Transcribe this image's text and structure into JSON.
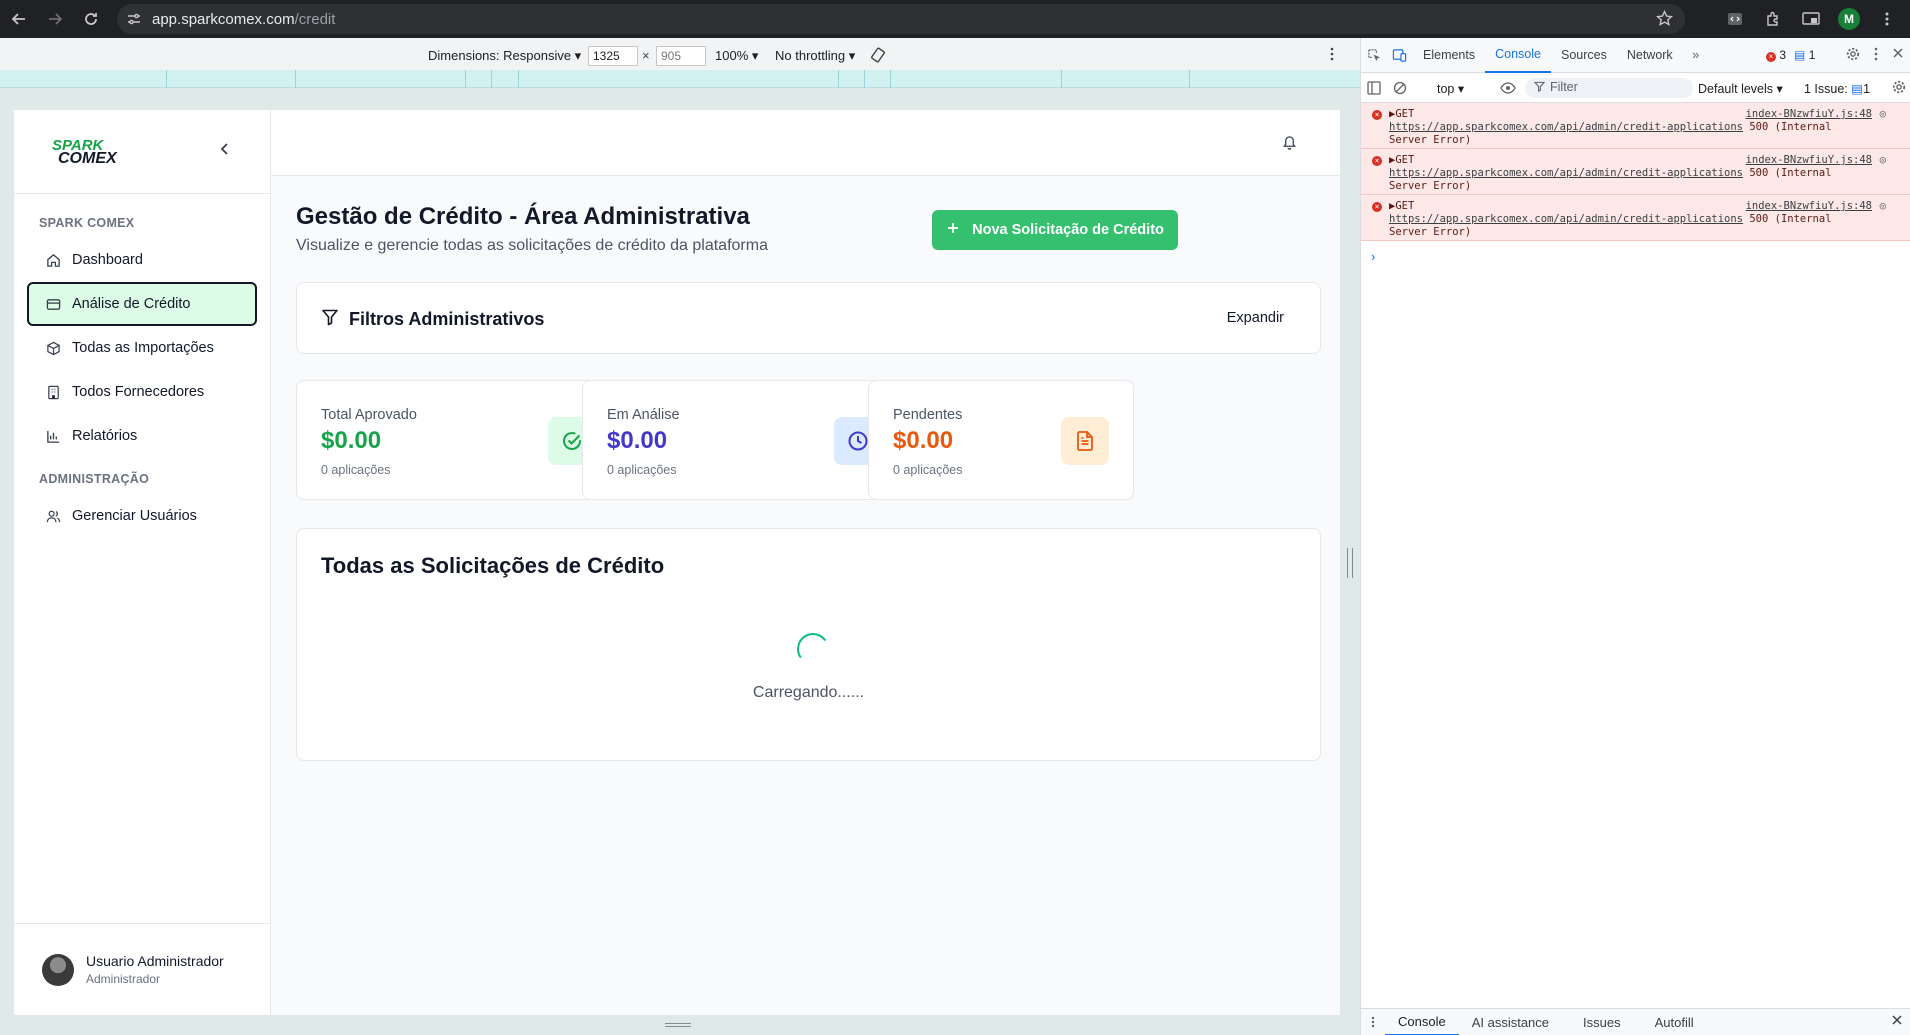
{
  "browser": {
    "url_host": "app.sparkcomex.com",
    "url_path": "/credit",
    "profile_initial": "M"
  },
  "device_toolbar": {
    "dimensions_label": "Dimensions: Responsive ▾",
    "width": "1325",
    "height": "905",
    "zoom": "100% ▾",
    "throttling": "No throttling ▾"
  },
  "sidebar": {
    "logo_line1": "SPARK",
    "logo_line2": "COMEX",
    "section1_title": "SPARK COMEX",
    "items": [
      {
        "label": "Dashboard",
        "icon": "home-icon"
      },
      {
        "label": "Análise de Crédito",
        "icon": "credit-card-icon",
        "active": true
      },
      {
        "label": "Todas as Importações",
        "icon": "package-icon"
      },
      {
        "label": "Todos Fornecedores",
        "icon": "building-icon"
      },
      {
        "label": "Relatórios",
        "icon": "bar-chart-icon"
      }
    ],
    "section2_title": "ADMINISTRAÇÃO",
    "admin_items": [
      {
        "label": "Gerenciar Usuários",
        "icon": "users-icon"
      }
    ],
    "user": {
      "name": "Usuario Administrador",
      "role": "Administrador"
    }
  },
  "main": {
    "title": "Gestão de Crédito - Área Administrativa",
    "subtitle": "Visualize e gerencie todas as solicitações de crédito da plataforma",
    "new_button": "Nova Solicitação de Crédito",
    "filters": {
      "title": "Filtros Administrativos",
      "expand": "Expandir"
    },
    "stats": [
      {
        "label": "Total Aprovado",
        "value": "$0.00",
        "sub": "0 aplicações",
        "color": "#16a34a",
        "bg": "#dcfce7",
        "icon": "check-circle-icon"
      },
      {
        "label": "Em Análise",
        "value": "$0.00",
        "sub": "0 aplicações",
        "color": "#4338ca",
        "bg": "#dbeafe",
        "icon": "clock-icon"
      },
      {
        "label": "Pendentes",
        "value": "$0.00",
        "sub": "0 aplicações",
        "color": "#ea580c",
        "bg": "#ffedd5",
        "icon": "file-text-icon"
      }
    ],
    "list_title": "Todas as Solicitações de Crédito",
    "loading_text": "Carregando......"
  },
  "devtools": {
    "tabs": [
      "Elements",
      "Console",
      "Sources",
      "Network"
    ],
    "active_tab": "Console",
    "error_count": "3",
    "message_count": "1",
    "context": "top ▾",
    "filter_placeholder": "Filter",
    "levels": "Default levels ▾",
    "issues": "1 Issue:",
    "issues_count": "1",
    "logs": [
      {
        "method": "▶GET",
        "url": "https://app.sparkcomex.com/api/admin/credit-applications",
        "status": "500 (Internal",
        "status2": "Server Error)",
        "source": "index-BNzwfiuY.js:48"
      },
      {
        "method": "▶GET",
        "url": "https://app.sparkcomex.com/api/admin/credit-applications",
        "status": "500 (Internal",
        "status2": "Server Error)",
        "source": "index-BNzwfiuY.js:48"
      },
      {
        "method": "▶GET",
        "url": "https://app.sparkcomex.com/api/admin/credit-applications",
        "status": "500 (Internal",
        "status2": "Server Error)",
        "source": "index-BNzwfiuY.js:48"
      }
    ],
    "prompt": "›",
    "drawer_tabs": [
      "Console",
      "AI assistance",
      "Issues",
      "Autofill"
    ]
  }
}
